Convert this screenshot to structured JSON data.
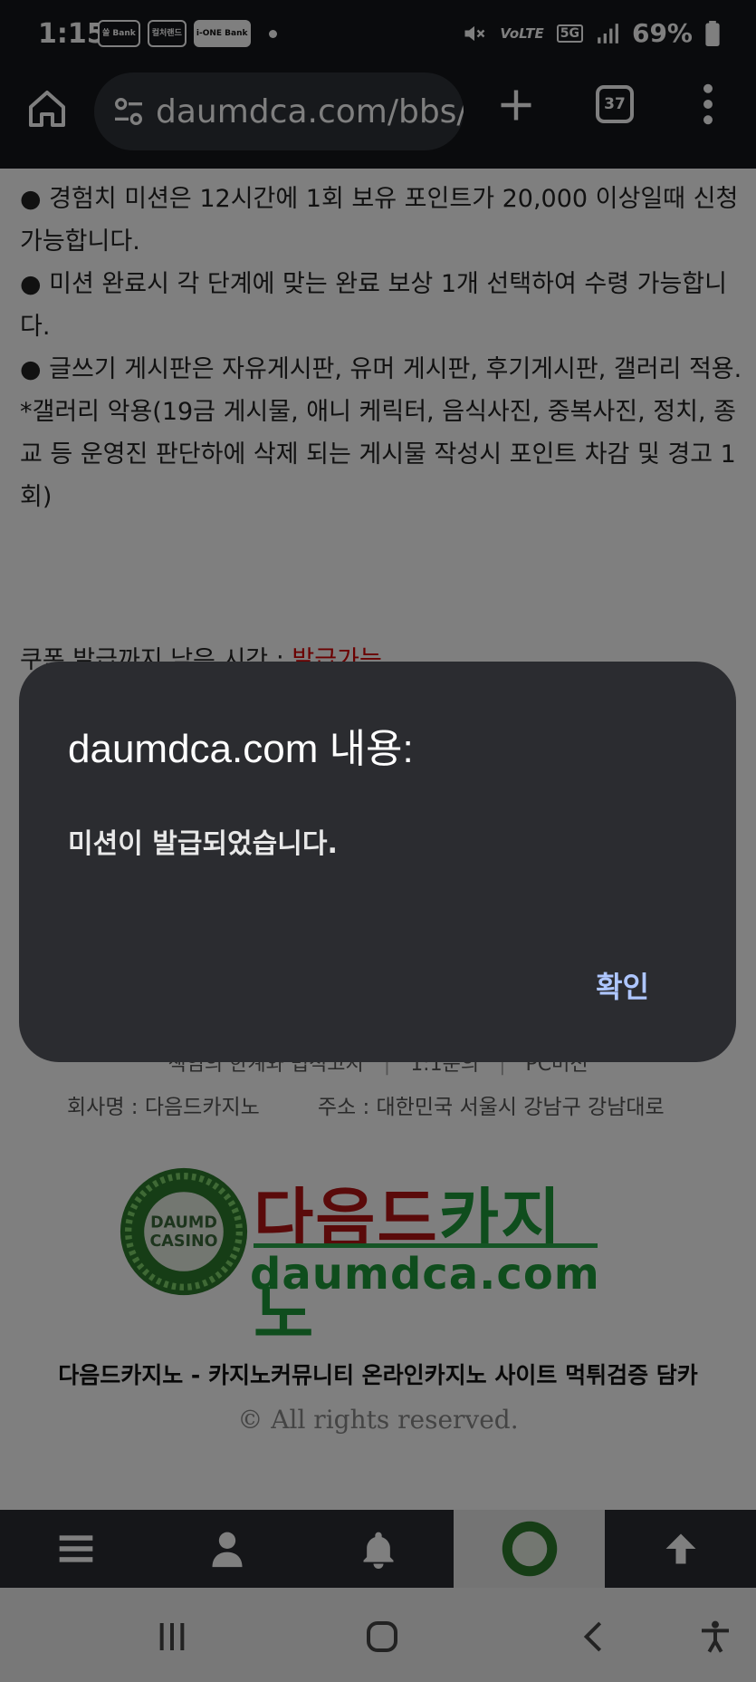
{
  "status_bar": {
    "time": "1:15",
    "apps": [
      "쏠 Bank",
      "컬처랜드",
      "i-ONE Bank"
    ],
    "battery": "69%",
    "network": "5G",
    "volte": "VoLTE"
  },
  "browser": {
    "url": "daumdca.com/bbs/",
    "tab_count": "37"
  },
  "page": {
    "notice_lines": [
      "● 경험치 미션은 12시간에 1회 보유 포인트가 20,000 이상일때 신청 가능합니다.",
      "● 미션 완료시 각 단계에 맞는 완료 보상 1개 선택하여 수령 가능합니다.",
      "● 글쓰기 게시판은 자유게시판, 유머 게시판, 후기게시판, 갤러리 적용.",
      "   *갤러리 악용(19금 게시물, 애니 케릭터, 음식사진, 중복사진, 정치, 종교 등 운영진 판단하에 삭제 되는 게시물 작성시 포인트 차감 및 경고 1회)"
    ],
    "coupon_label": "쿠폰 발급까지 남은 시간 : ",
    "coupon_status": "발급가능",
    "footer_links": [
      "책임의 한계와 법적고지",
      "1:1문의",
      "PC버전"
    ],
    "company": "회사명 : 다음드카지노",
    "address": "주소 : 대한민국 서울시 강남구 강남대로",
    "logo": {
      "kr_red": "다음드",
      "kr_green": "카지노",
      "en": "daumdca.com",
      "badge_line1": "DAUMD",
      "badge_line2": "CASINO"
    },
    "site_title": "다음드카지노 - 카지노커뮤니티 온라인카지노 사이트 먹튀검증 담카",
    "copyright": "© All rights reserved."
  },
  "dialog": {
    "title": "daumdca.com 내용:",
    "message": "미션이 발급되었습니다.",
    "ok_label": "확인"
  },
  "colors": {
    "accent_red": "#d40000",
    "dialog_bg": "#2b2c30",
    "dialog_button": "#aec6ff",
    "logo_red": "#b51414",
    "logo_green": "#1e9a3a"
  },
  "icons": {
    "site_nav": [
      "menu-icon",
      "user-icon",
      "bell-icon",
      "logo-icon",
      "arrow-up-icon"
    ],
    "system_nav": [
      "recents-icon",
      "home-icon",
      "back-icon",
      "accessibility-icon"
    ]
  }
}
